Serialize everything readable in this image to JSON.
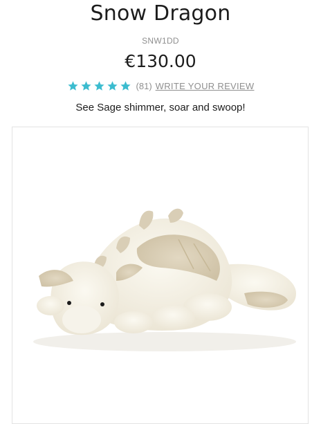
{
  "product": {
    "title": "Snow Dragon",
    "sku": "SNW1DD",
    "price": "€130.00",
    "tagline": "See Sage shimmer, soar and swoop!"
  },
  "rating": {
    "stars": 5,
    "count_label": "(81)",
    "review_link_label": "WRITE YOUR REVIEW",
    "star_color": "#3cbccf"
  },
  "image": {
    "subject": "plush-snow-dragon-image"
  }
}
